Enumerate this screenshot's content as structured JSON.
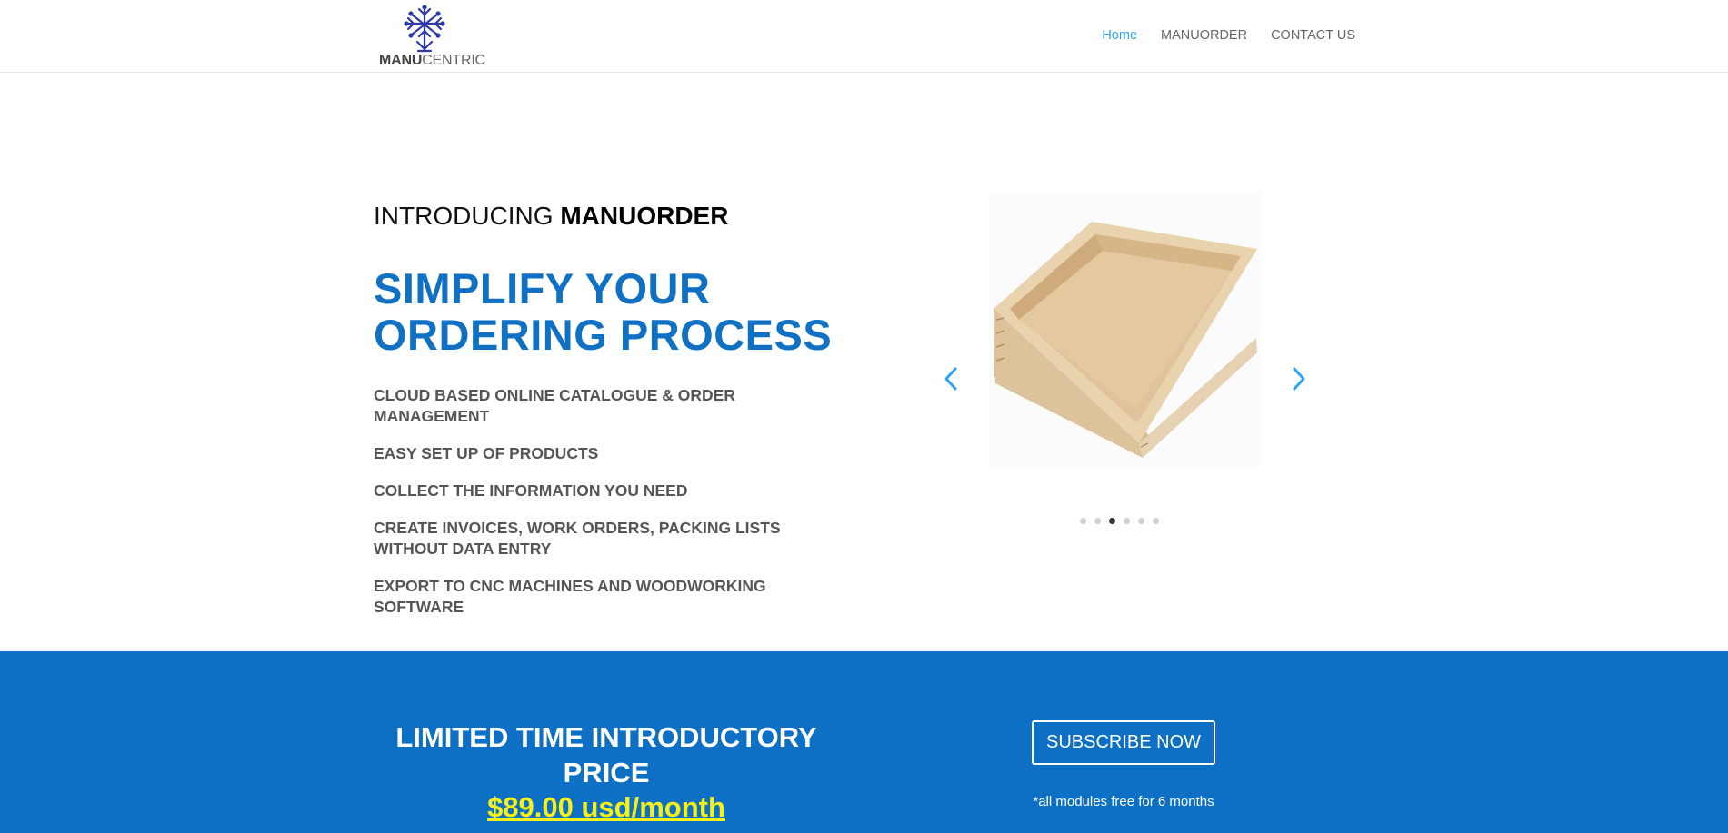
{
  "header": {
    "logo": {
      "text_bold": "MANU",
      "text_light": "CENTRIC"
    },
    "nav": [
      {
        "label": "Home",
        "active": true
      },
      {
        "label": "MANUORDER",
        "active": false
      },
      {
        "label": "CONTACT US",
        "active": false
      }
    ]
  },
  "hero": {
    "intro_prefix": "INTRODUCING ",
    "intro_product": "MANUORDER",
    "headline_line1": "SIMPLIFY YOUR",
    "headline_line2": "ORDERING PROCESS",
    "features": [
      "CLOUD BASED ONLINE CATALOGUE & ORDER MANAGEMENT",
      "EASY SET UP OF PRODUCTS",
      "COLLECT THE INFORMATION YOU NEED",
      "CREATE INVOICES, WORK ORDERS, PACKING LISTS WITHOUT DATA ENTRY",
      "EXPORT TO CNC MACHINES AND WOODWORKING SOFTWARE"
    ]
  },
  "slider": {
    "icons": {
      "prev": "chevron-left-icon",
      "next": "chevron-right-icon"
    },
    "slide_count": 6,
    "active_slide": 3
  },
  "promo": {
    "title": "LIMITED TIME INTRODUCTORY PRICE",
    "price": "$89.00 usd/month",
    "subscribe_label": "SUBSCRIBE NOW",
    "note": "*all modules free for 6 months"
  },
  "colors": {
    "brand_blue": "#0d70c5",
    "headline_blue": "#1071c4",
    "nav_active": "#2ea3f2",
    "price_yellow": "#f5f01a",
    "logo_blue": "#2d3aa8"
  }
}
